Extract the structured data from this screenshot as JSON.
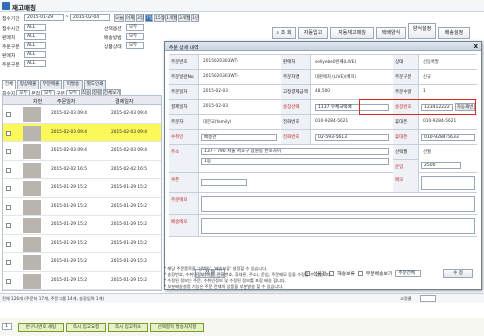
{
  "window": {
    "title": "재고매칭"
  },
  "filters": {
    "date_label": "접수기간",
    "date_from": "2015-01-29",
    "date_to": "2015-02-04",
    "quick_dates": [
      "오늘",
      "어제",
      "3일",
      "7일",
      "15일",
      "1개월",
      "3개월",
      "1년"
    ],
    "row2_label": "접수시간",
    "row2_value": "ALL",
    "row3_label": "판매처",
    "row3_value": "ALL",
    "row4_label": "주문구분",
    "row4_value": "ALL",
    "option_label": "선택옵션",
    "option_value": "모두",
    "type_label": "배송방법",
    "type_value": "모두",
    "status_label": "상품상태",
    "status_value": "모두"
  },
  "toolbar": {
    "search": "조 회",
    "excel1": "자동입고",
    "excel2": "자동재고매칭",
    "excel3": "택배양식",
    "excel4": "양식설정",
    "excel5": "배송설정"
  },
  "tabs": [
    "전체",
    "정상매출",
    "부분매출",
    "미발송",
    "별도인쇄"
  ],
  "grid": {
    "filters": [
      "회수지",
      "모두",
      "본점",
      "모두",
      "구분",
      "모두",
      "적용",
      "정렬",
      "전체보기"
    ],
    "headers": [
      "",
      "차번",
      "주문일자",
      "결제일자"
    ],
    "rows": [
      {
        "no": "",
        "ordered": "2015-02-03 09:4",
        "paid": "2015-02-03 09:4",
        "hl": false
      },
      {
        "no": "",
        "ordered": "2015-02-03 09:4",
        "paid": "2015-02-03 09:4",
        "hl": true
      },
      {
        "no": "",
        "ordered": "2015-02-03 09:4",
        "paid": "2015-02-03 09:4",
        "hl": false
      },
      {
        "no": "",
        "ordered": "2015-02-02 16:5",
        "paid": "2015-02-02 16:5",
        "hl": false
      },
      {
        "no": "",
        "ordered": "2015-01-29 15:2",
        "paid": "2015-01-29 15:2",
        "hl": false
      },
      {
        "no": "",
        "ordered": "2015-01-29 15:2",
        "paid": "2015-01-29 15:2",
        "hl": false
      },
      {
        "no": "",
        "ordered": "2015-01-29 15:2",
        "paid": "2015-01-29 15:2",
        "hl": false
      },
      {
        "no": "",
        "ordered": "2015-01-29 15:2",
        "paid": "2015-01-29 15:2",
        "hl": false
      },
      {
        "no": "",
        "ordered": "2015-01-29 15:2",
        "paid": "2015-01-29 15:2",
        "hl": false
      },
      {
        "no": "",
        "ordered": "2015-01-29 15:2",
        "paid": "2015-01-29 15:2",
        "hl": false
      }
    ]
  },
  "modal": {
    "title": "주문 상세 내역",
    "close": "x",
    "fields": {
      "r1": {
        "l1": "주문번호",
        "v1": "2015020303WT-",
        "l2": "판매처",
        "v2": "sellyebe0번째(LIVE)",
        "l3": "상태",
        "v3": "선등록발"
      },
      "r2": {
        "l1": "주문일련No",
        "v1": "2015020303WT-",
        "l2": "주문자명",
        "v2": "대판매처 (LIVE)(배치)",
        "l3": "주문구분",
        "v3": "신규"
      },
      "r3": {
        "l1": "주문일자",
        "v1": "2015-02-03",
        "l2": "고정결제금액",
        "v2": "48,500",
        "l3": "주문수량",
        "v3": "1"
      },
      "r4": {
        "l1": "결제일자",
        "v1": "2015-02-03",
        "l2": "송장선택",
        "v2": "1137  우체국택배",
        "l3": "송장번호",
        "v3": "123412222"
      },
      "r5": {
        "l1": "주문자",
        "v1": "대한교(family)",
        "l2": "전화번호",
        "v2": "010-9284-5621",
        "l3": "휴대폰",
        "v3": "010-9284-5621"
      },
      "r6": {
        "l1": "수취인",
        "v1": "배송관",
        "l2": "전화번호",
        "v2": "02-593-5613",
        "l3": "휴대폰",
        "v3": "010-9284-5633"
      },
      "r7": {
        "l1": "주소",
        "v1": "137 - 790  서울 서초구 잠원동 반포자이",
        "v1b": "1동",
        "l3": "선택월",
        "v3": "선월"
      },
      "r8": {
        "l3": "운임",
        "v3": "2500"
      },
      "r9": {
        "l1": "쿠폰",
        "l3": "메모"
      },
      "r10": {
        "l1": "주문메모"
      },
      "r11": {
        "l1": "배송메모"
      }
    },
    "invoice_btn": "자동재번",
    "delete_btn": "삭 제",
    "check1": "선물정",
    "check2": "해송보류",
    "check3": "부분배송보기",
    "sel_label": "주문전체",
    "ok_btn": "수 정",
    "notes": [
      "* 해당 주문품목을 '선택된', '배송보류' 설정할 수 있습니다.",
      "* 송장번호, 수취인정보(이름, 전화번호, 휴대폰, 주소), 운임, 주문메모 등을 수정할 수 있습니다.",
      "* 수정된 정보는 주문, 수취인정보 및 수정된 정보를 포함 배송 합니다.",
      "* 부분배송설정 기능은 주문 전체의 상품을 부분발송 할 수 있습니다."
    ]
  },
  "status": {
    "left": "전체 126개 (주문처 17개, 주문그룹 14개, 송장입력 1개)",
    "page": "1",
    "right_label": "고정쿨"
  },
  "footer": {
    "b1": "반구니번호 세팅",
    "b2": "즉시 입고요청",
    "b3": "즉시 입고취소",
    "b4": "선택항목 발송처지정"
  },
  "colors": {
    "accent": "#2f6db5",
    "highlight": "#fbf85a",
    "red_box": "#d22a2a"
  }
}
